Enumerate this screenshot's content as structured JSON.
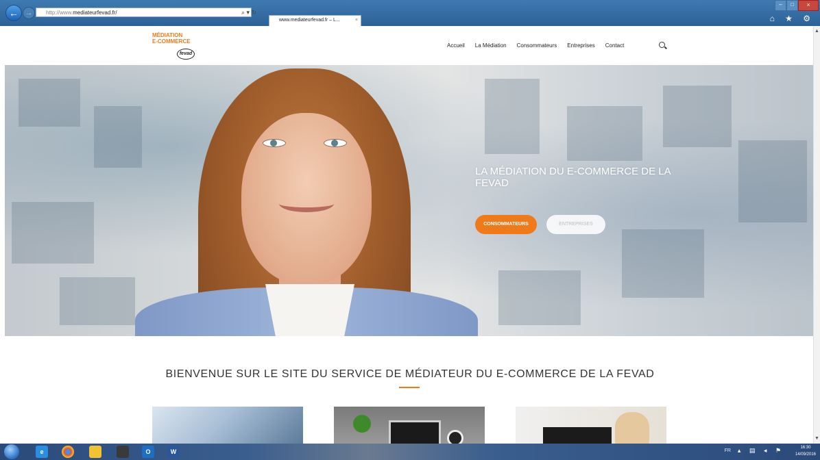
{
  "browser": {
    "address_prefix": "http://www.",
    "address_url": "mediateurfevad.fr/",
    "address_tools": "⌕ ▾ ↻",
    "tab_title": "www.mediateurfevad.fr – L...",
    "tab_close": "×",
    "win_minimize": "–",
    "win_maximize": "□",
    "win_close": "×",
    "toolbar_icons": "⌂ ★ ⚙"
  },
  "site": {
    "logo_line1": "MÉDIATION",
    "logo_line2": "E-COMMERCE",
    "logo_badge": "fevad",
    "menu": [
      {
        "label": "Accueil"
      },
      {
        "label": "La Médiation"
      },
      {
        "label": "Consommateurs"
      },
      {
        "label": "Entreprises"
      },
      {
        "label": "Contact"
      }
    ]
  },
  "hero": {
    "title": "LA MÉDIATION DU E-COMMERCE DE LA FEVAD",
    "btn_consumers": "CONSOMMATEURS",
    "btn_companies": "ENTREPRISES"
  },
  "welcome": {
    "heading": "BIENVENUE SUR LE SITE DU SERVICE DE MÉDIATEUR DU E-COMMERCE DE LA FEVAD"
  },
  "taskbar": {
    "word_label": "W",
    "outlook_label": "O",
    "lang": "FR",
    "tray_icons": "▴ ▤ ◂ ⚑",
    "time": "16:30",
    "date": "14/09/2016"
  },
  "colors": {
    "accent_orange": "#f07a1a",
    "menu_text": "#222222"
  }
}
